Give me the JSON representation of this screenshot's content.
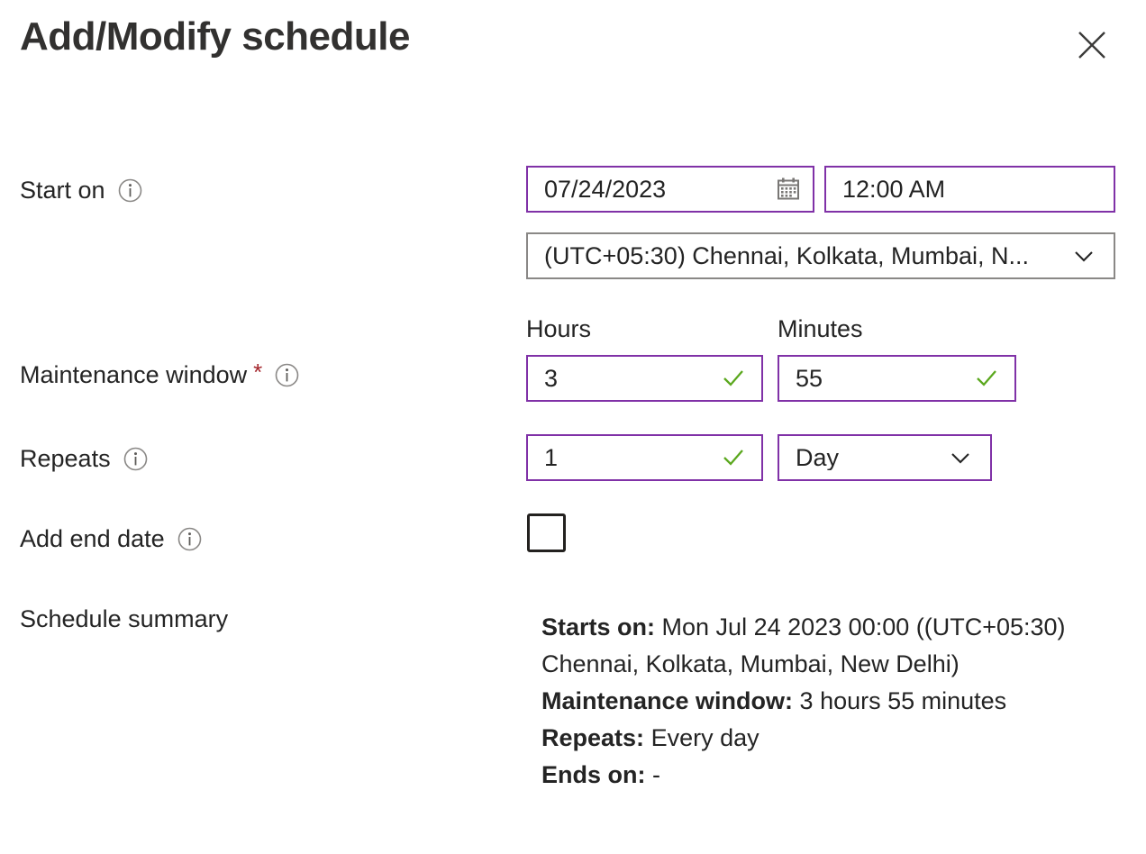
{
  "dialog": {
    "title": "Add/Modify schedule",
    "close_label": "Close",
    "close_icon": "close-icon"
  },
  "form": {
    "start_on": {
      "label": "Start on",
      "info_icon": "info-icon",
      "date": {
        "value": "07/24/2023",
        "placeholder": "mm/dd/yyyy",
        "icon": "calendar-icon"
      },
      "time": {
        "value": "12:00 AM",
        "placeholder": "hh:mm AM"
      },
      "timezone": {
        "value": "(UTC+05:30) Chennai, Kolkata, Mumbai, N...",
        "icon": "chevron-down-icon"
      }
    },
    "maintenance_window": {
      "label": "Maintenance window",
      "required_marker": "*",
      "info_icon": "info-icon",
      "hours": {
        "label": "Hours",
        "value": "3",
        "validation_icon": "checkmark-icon"
      },
      "minutes": {
        "label": "Minutes",
        "value": "55",
        "validation_icon": "checkmark-icon"
      }
    },
    "repeats": {
      "label": "Repeats",
      "info_icon": "info-icon",
      "interval": {
        "value": "1",
        "validation_icon": "checkmark-icon"
      },
      "unit": {
        "value": "Day",
        "icon": "chevron-down-icon"
      }
    },
    "add_end_date": {
      "label": "Add end date",
      "info_icon": "info-icon",
      "checked": false
    },
    "schedule_summary": {
      "label": "Schedule summary",
      "lines": [
        {
          "key": "Starts on:",
          "value": "Mon Jul 24 2023 00:00 ((UTC+05:30) Chennai, Kolkata, Mumbai, New Delhi)"
        },
        {
          "key": "Maintenance window:",
          "value": "3 hours 55 minutes"
        },
        {
          "key": "Repeats:",
          "value": "Every day"
        },
        {
          "key": "Ends on:",
          "value": "-"
        }
      ]
    }
  },
  "colors": {
    "accent_purple": "#8031a7",
    "validation_green": "#5ba81e",
    "required_red": "#a4262c",
    "text": "#242424",
    "border_gray": "#8a8886"
  }
}
